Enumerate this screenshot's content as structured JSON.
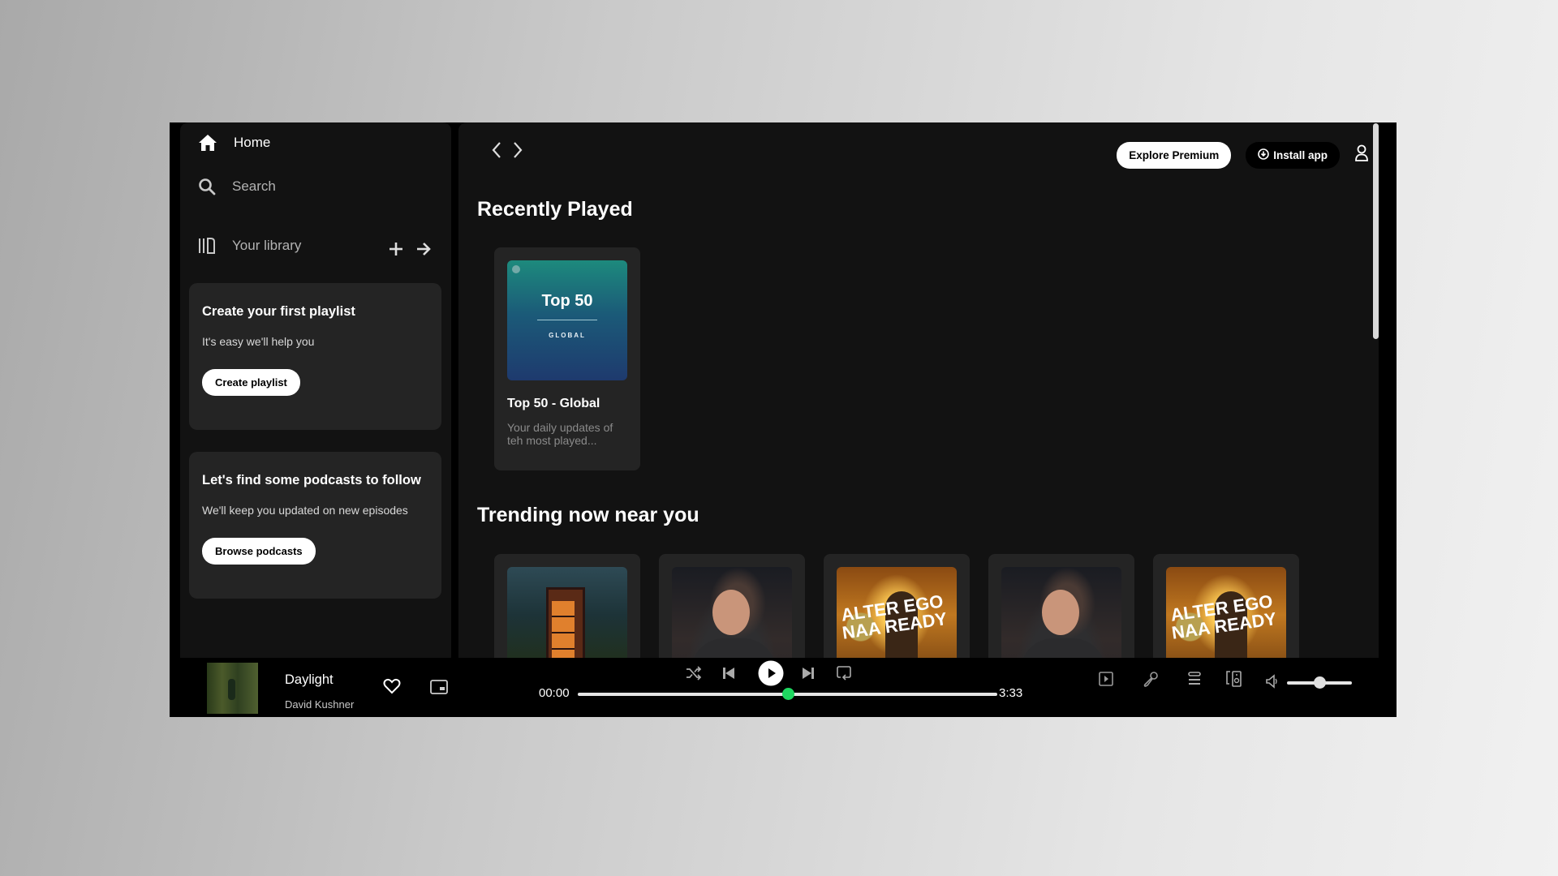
{
  "sidebar": {
    "home_label": "Home",
    "search_label": "Search",
    "library_label": "Your library",
    "playlist_card": {
      "title": "Create your first playlist",
      "description": "It's easy we'll help you",
      "button": "Create playlist"
    },
    "podcast_card": {
      "title": "Let's find some podcasts to follow",
      "description": "We'll keep you updated on new episodes",
      "button": "Browse podcasts"
    }
  },
  "header": {
    "explore_premium": "Explore Premium",
    "install_app": "Install app"
  },
  "recently_played": {
    "title": "Recently Played",
    "items": [
      {
        "cover_title": "Top 50",
        "cover_subtitle": "GLOBAL",
        "title": "Top 50 - Global",
        "description": "Your daily updates of teh most played..."
      }
    ]
  },
  "trending": {
    "title": "Trending now near you",
    "items": [
      {
        "art": "phone-booth-cover"
      },
      {
        "art": "singer-portrait-cover"
      },
      {
        "art": "leo-alter-ego-cover",
        "cover_text": "ALTER EGO NAA READY"
      },
      {
        "art": "singer-portrait-cover"
      },
      {
        "art": "leo-alter-ego-cover",
        "cover_text": "ALTER EGO NAA READY"
      }
    ]
  },
  "player": {
    "track_title": "Daylight",
    "artist": "David Kushner",
    "elapsed": "00:00",
    "duration": "3:33",
    "progress_fraction": 0.5,
    "volume_fraction": 0.5,
    "accent_color": "#1ed760"
  }
}
